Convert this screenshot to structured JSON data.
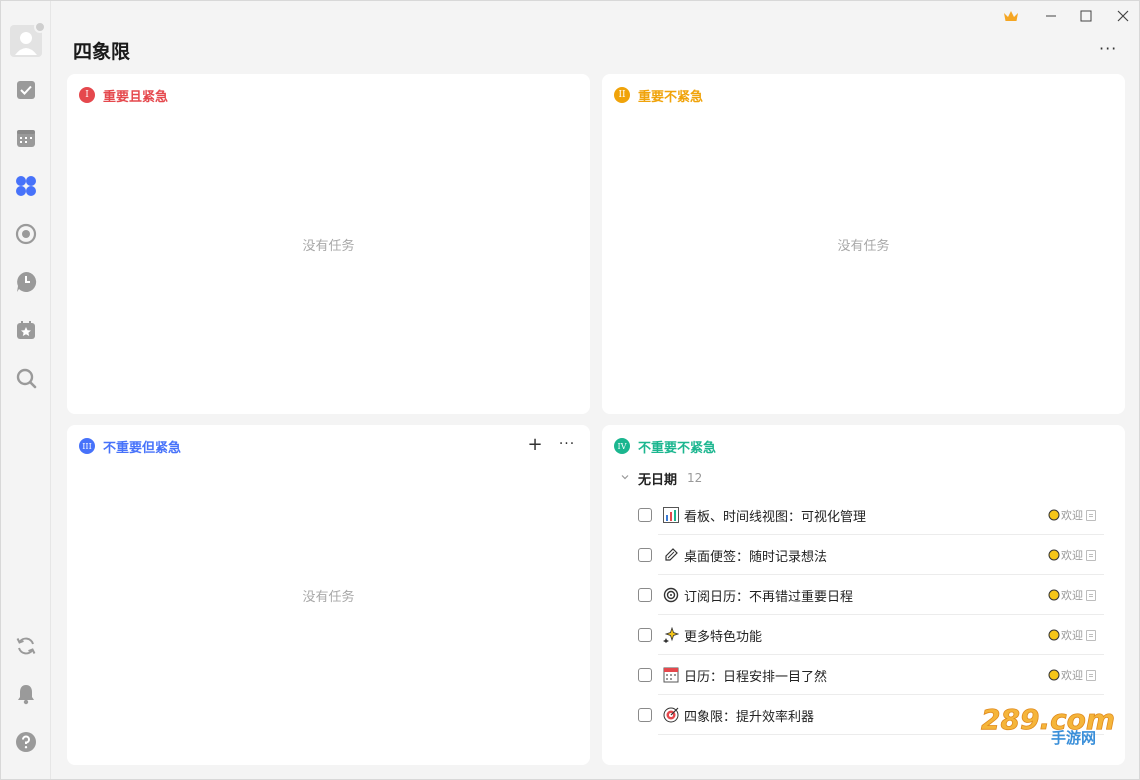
{
  "window": {
    "title": "四象限",
    "more_label": "···"
  },
  "sidebar": {
    "items": [
      {
        "name": "task-icon",
        "label": "任务"
      },
      {
        "name": "calendar-icon",
        "label": "日历"
      },
      {
        "name": "quadrant-icon",
        "label": "四象限",
        "active": true
      },
      {
        "name": "focus-icon",
        "label": "专注"
      },
      {
        "name": "habit-icon",
        "label": "习惯"
      },
      {
        "name": "countdown-icon",
        "label": "倒数日"
      },
      {
        "name": "search-icon",
        "label": "搜索"
      }
    ],
    "bottom": [
      {
        "name": "sync-icon"
      },
      {
        "name": "notification-bell-icon"
      },
      {
        "name": "help-icon"
      }
    ]
  },
  "colors": {
    "q1": "#e5484d",
    "q2": "#f0a30a",
    "q3": "#4772fa",
    "q4": "#1bb68f",
    "accent": "#4772fa",
    "crown": "#f5a623"
  },
  "quadrants": {
    "q1": {
      "numeral": "I",
      "title": "重要且紧急",
      "empty_text": "没有任务"
    },
    "q2": {
      "numeral": "II",
      "title": "重要不紧急",
      "empty_text": "没有任务"
    },
    "q3": {
      "numeral": "III",
      "title": "不重要但紧急",
      "empty_text": "没有任务",
      "add_label": "+",
      "more_label": "···"
    },
    "q4": {
      "numeral": "IV",
      "title": "不重要不紧急",
      "group": {
        "title": "无日期",
        "count": "12"
      },
      "tasks": [
        {
          "icon": "bar-chart-icon",
          "text": "看板、时间线视图：可视化管理",
          "tag": "欢迎"
        },
        {
          "icon": "sticky-note-icon",
          "text": "桌面便签：随时记录想法",
          "tag": "欢迎"
        },
        {
          "icon": "subscribe-icon",
          "text": "订阅日历：不再错过重要日程",
          "tag": "欢迎"
        },
        {
          "icon": "sparkle-icon",
          "text": "更多特色功能",
          "tag": "欢迎"
        },
        {
          "icon": "calendar-page-icon",
          "text": "日历：日程安排一目了然",
          "tag": "欢迎"
        },
        {
          "icon": "target-icon",
          "text": "四象限：提升效率利器",
          "tag": ""
        }
      ]
    }
  },
  "watermark": {
    "top": "289.com",
    "bottom": "手游网"
  }
}
